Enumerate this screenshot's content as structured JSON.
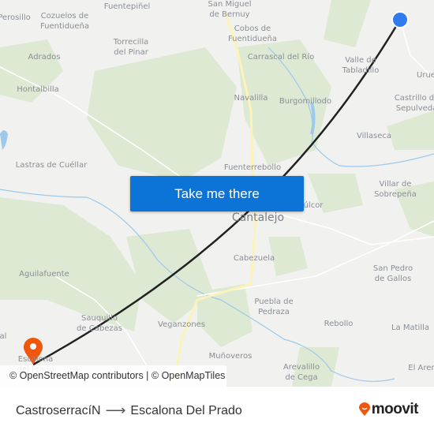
{
  "map": {
    "labels": [
      "Perosillo",
      "Cozuelos de\nFuentidueña",
      "Fuentepiñel",
      "San Miguel\nde Bernuy",
      "Cobos de\nFuentidueña",
      "Torrecilla\ndel Pinar",
      "Adrados",
      "Carrascal del Río",
      "Valle de\nTabladillo",
      "Urue",
      "Hontalbilla",
      "Navalilla",
      "Burgomillodo",
      "Castrillo de\nSepulveda",
      "Villaseca",
      "Lastras de Cuéllar",
      "Fuenterrebollo",
      "Villar de\nSobrepeña",
      "Cantalejo",
      "úlcor",
      "Cabezuela",
      "San Pedro\nde Gallos",
      "Aguilafuente",
      "Puebla de\nPedraza",
      "Sauquillo\nde Cabezas",
      "Veganzones",
      "Rebollo",
      "La Matilla",
      "Muñoveros",
      "Escalona\ndel Prado",
      "Arevalillo\nde Cega",
      "El Aren",
      "al"
    ],
    "origin_color": "#2f7bef",
    "destination_color": "#f2560d",
    "route_color": "#222222",
    "forest_color": "#dde9d2",
    "water_color": "#9cc9ec",
    "main_road_color": "#fbf3b8",
    "origin_icon": "origin-dot-icon",
    "destination_icon": "map-pin-icon"
  },
  "cta": {
    "label": "Take me there"
  },
  "attribution": "© OpenStreetMap contributors | © OpenMapTiles",
  "footer": {
    "origin": "CastroserracíN",
    "arrow": "⟶",
    "destination": "Escalona Del Prado",
    "brand": "moovit"
  }
}
